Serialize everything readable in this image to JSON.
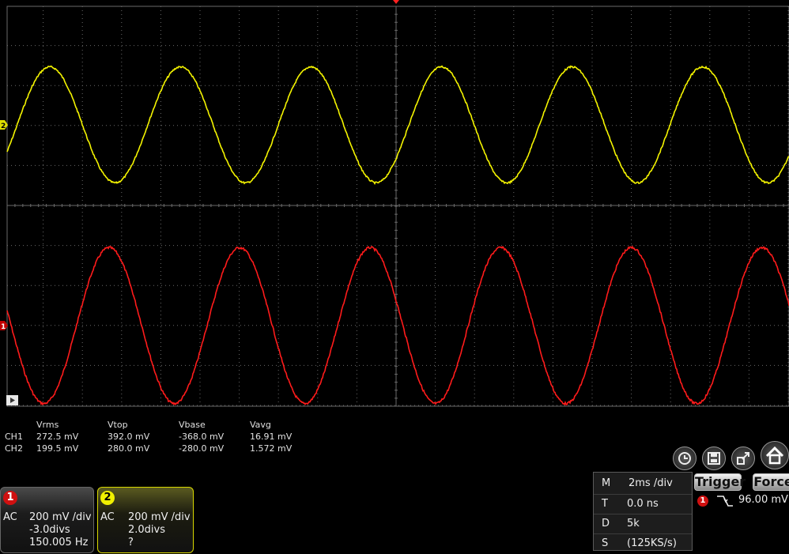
{
  "colors": {
    "ch1": "#ff1b1b",
    "ch2": "#f4f400",
    "grid": "#6a6a6a"
  },
  "scope": {
    "timebase": "2ms/div",
    "ch1_trace": {
      "amplitude_divs": 1.95,
      "period_divs": 3.33
    },
    "ch2_trace": {
      "amplitude_divs": 1.45,
      "period_divs": 3.33
    }
  },
  "measurements": {
    "headers": [
      "Vrms",
      "Vtop",
      "Vbase",
      "Vavg"
    ],
    "rows": [
      {
        "channel": "CH1",
        "values": [
          "272.5 mV",
          "392.0 mV",
          "-368.0 mV",
          "16.91 mV"
        ]
      },
      {
        "channel": "CH2",
        "values": [
          "199.5 mV",
          "280.0 mV",
          "-280.0 mV",
          "1.572 mV"
        ]
      }
    ]
  },
  "ch1_panel": {
    "number": "1",
    "coupling": "AC",
    "scale": "200 mV /div",
    "offset": "-3.0divs",
    "freq": "150.005 Hz"
  },
  "ch2_panel": {
    "number": "2",
    "coupling": "AC",
    "scale": "200 mV /div",
    "offset": "2.0divs",
    "freq": "?"
  },
  "timebase_panel": [
    {
      "key": "M",
      "value": "2ms /div"
    },
    {
      "key": "T",
      "value": "0.0 ns"
    },
    {
      "key": "D",
      "value": "5k"
    },
    {
      "key": "S",
      "value": "(125KS/s)"
    }
  ],
  "trigger": {
    "label": "Trigger",
    "force_label": "Force",
    "source": "1",
    "level": "96.00 mV"
  },
  "markers": {
    "ch1": "1",
    "ch2": "2"
  },
  "toolbar_icons": [
    "screenshot-icon",
    "save-icon",
    "export-icon",
    "home-icon"
  ]
}
